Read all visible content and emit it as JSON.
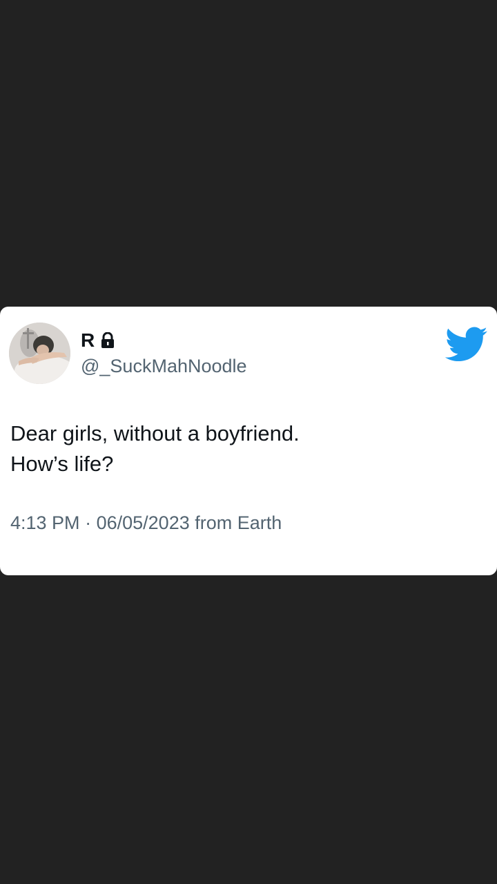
{
  "tweet": {
    "author": {
      "display_name": "R",
      "handle": "@_SuckMahNoodle",
      "protected_icon": "lock-icon",
      "avatar": "profile-photo"
    },
    "brand_icon": "twitter-bird-icon",
    "brand_color": "#1d9bf0",
    "text_lines": [
      "Dear girls, without a boyfriend.",
      "How’s life?"
    ],
    "time": "4:13 PM",
    "separator": "·",
    "date": "06/05/2023",
    "source": "from Earth"
  },
  "colors": {
    "background": "#222222",
    "card": "#ffffff",
    "primary_text": "#0f1419",
    "secondary_text": "#536471"
  }
}
